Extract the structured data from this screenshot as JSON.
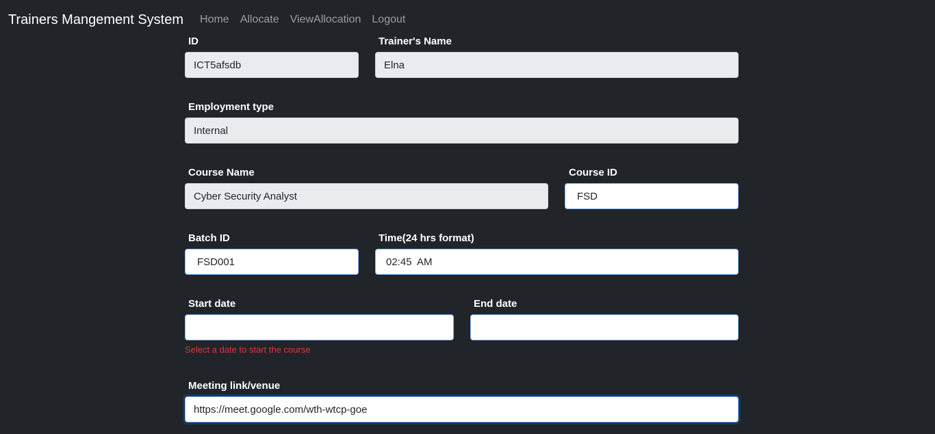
{
  "navbar": {
    "brand": "Trainers Mangement System",
    "links": [
      "Home",
      "Allocate",
      "ViewAllocation",
      "Logout"
    ]
  },
  "form": {
    "id": {
      "label": "ID",
      "value": "ICT5afsdb"
    },
    "trainer_name": {
      "label": "Trainer's Name",
      "value": "Elna"
    },
    "employment_type": {
      "label": "Employment type",
      "value": "Internal"
    },
    "course_name": {
      "label": "Course Name",
      "value": "Cyber Security Analyst"
    },
    "course_id": {
      "label": "Course ID",
      "value": "FSD"
    },
    "batch_id": {
      "label": "Batch ID",
      "value": "FSD001"
    },
    "time": {
      "label": "Time(24 hrs format)",
      "value": "02:45  AM"
    },
    "start_date": {
      "label": "Start date",
      "value": "",
      "error": "Select a date to start the course"
    },
    "end_date": {
      "label": "End date",
      "value": ""
    },
    "meeting_link": {
      "label": "Meeting link/venue",
      "value": "https://meet.google.com/wth-wtcp-goe"
    }
  },
  "colors": {
    "background": "#212529",
    "readonly_field": "#e9ecef",
    "focus_border": "#86b7fe",
    "error": "#dc3545"
  }
}
